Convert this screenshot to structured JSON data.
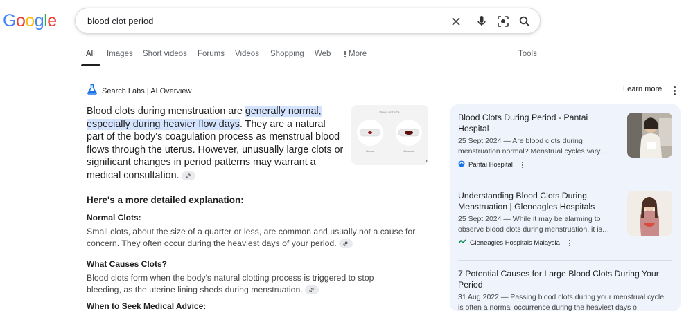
{
  "logo": {
    "letters": [
      "G",
      "o",
      "o",
      "g",
      "l",
      "e"
    ],
    "colors": [
      "#4285f4",
      "#ea4335",
      "#fbbc05",
      "#4285f4",
      "#34a853",
      "#ea4335"
    ]
  },
  "search": {
    "query": "blood clot period",
    "icons": [
      "close-icon",
      "mic-icon",
      "lens-icon",
      "search-icon"
    ]
  },
  "tabs": {
    "items": [
      "All",
      "Images",
      "Short videos",
      "Forums",
      "Videos",
      "Shopping",
      "Web",
      "More"
    ],
    "tools": "Tools",
    "active": "All"
  },
  "ai_overview": {
    "title": "Search Labs | AI Overview",
    "learn_more": "Learn more",
    "intro_before": "Blood clots during menstruation are ",
    "intro_highlight": "generally normal, especially during heavier flow days",
    "intro_after": ". They are a natural part of the body's coagulation process as menstrual blood flows through the uterus. However, unusually large clots or significant changes in period patterns may warrant a medical consultation.",
    "image_caption": "Blood clot size",
    "image_labels": [
      "Normal",
      "Abnormal"
    ],
    "section_heading": "Here's a more detailed explanation:",
    "sections": [
      {
        "heading": "Normal Clots:",
        "text": "Small clots, about the size of a quarter or less, are common and usually not a cause for concern. They often occur during the heaviest days of your period."
      },
      {
        "heading": "What Causes Clots?",
        "text": "Blood clots form when the body's natural clotting process is triggered to stop bleeding, as the uterine lining sheds during menstruation."
      },
      {
        "heading": "When to Seek Medical Advice:",
        "text": ""
      }
    ]
  },
  "sources": [
    {
      "title": "Blood Clots During Period - Pantai Hospital",
      "snippet": "25 Sept 2024 — Are blood clots during menstruation normal? Menstrual cycles vary…",
      "site": "Pantai Hospital"
    },
    {
      "title": "Understanding Blood Clots During Menstruation | Gleneagles Hospitals",
      "snippet": "25 Sept 2024 — While it may be alarming to observe blood clots during menstruation, it is…",
      "site": "Gleneagles Hospitals Malaysia"
    },
    {
      "title": "7 Potential Causes for Large Blood Clots During Your Period",
      "snippet": "31 Aug 2022 — Passing blood clots during your menstrual cycle is often a normal occurrence during the heaviest days o",
      "site": ""
    }
  ],
  "colors": {
    "accent": "#1a73e8",
    "highlight": "#d3e3fd",
    "panel": "#eef3fc"
  }
}
